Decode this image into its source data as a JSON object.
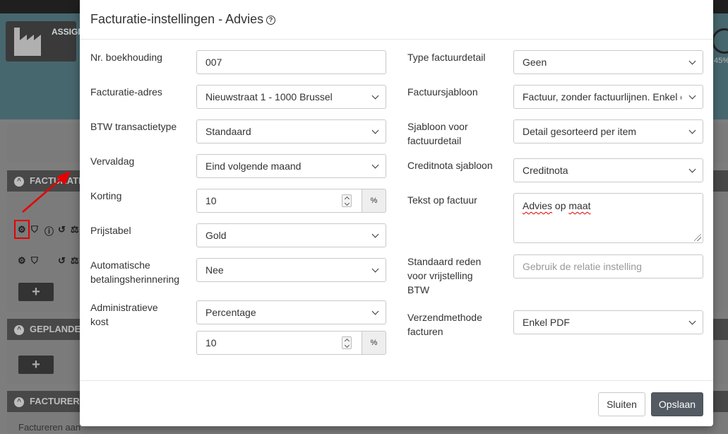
{
  "background": {
    "app_title": "ASSIGN",
    "gauge_percent": "45%",
    "panels": [
      {
        "title": "FACTURATIE"
      },
      {
        "title": "GEPLANDE"
      },
      {
        "title": "FACTURERE"
      }
    ],
    "footer_text": "Factureren aan"
  },
  "modal": {
    "title": "Facturatie-instellingen - Advies",
    "left_fields": [
      {
        "label": "Nr. boekhouding",
        "value": "007",
        "type": "text"
      },
      {
        "label": "Facturatie-adres",
        "value": "Nieuwstraat 1 - 1000 Brussel",
        "type": "select"
      },
      {
        "label": "BTW transactietype",
        "value": "Standaard",
        "type": "select"
      },
      {
        "label": "Vervaldag",
        "value": "Eind volgende maand",
        "type": "select"
      },
      {
        "label": "Korting",
        "value": "10",
        "addon": "%",
        "type": "number"
      },
      {
        "label": "Prijstabel",
        "value": "Gold",
        "type": "select"
      },
      {
        "label": "Automatische betalingsherinnering",
        "value": "Nee",
        "type": "select"
      },
      {
        "label": "Administratieve kost",
        "value": "Percentage",
        "type": "select",
        "amount": "10",
        "addon": "%"
      }
    ],
    "right_fields": [
      {
        "label": "Type factuurdetail",
        "value": "Geen",
        "type": "select"
      },
      {
        "label": "Factuursjabloon",
        "value": "Factuur, zonder factuurlijnen. Enkel omschrijving",
        "type": "select"
      },
      {
        "label": "Sjabloon voor factuurdetail",
        "value": "Detail gesorteerd per item",
        "type": "select"
      },
      {
        "label": "Creditnota sjabloon",
        "value": "Creditnota",
        "type": "select"
      },
      {
        "label": "Tekst op factuur",
        "value_words": [
          "Advies",
          "op",
          "maat"
        ],
        "type": "textarea"
      },
      {
        "label": "Standaard reden voor vrijstelling BTW",
        "placeholder": "Gebruik de relatie instelling",
        "type": "text"
      },
      {
        "label": "Verzendmethode facturen",
        "value": "Enkel PDF",
        "type": "select"
      }
    ],
    "buttons": {
      "close": "Sluiten",
      "save": "Opslaan"
    }
  },
  "colors": {
    "overlay": "#7d7d7d",
    "save_button": "#535a61",
    "annotation_red": "#e60000"
  }
}
